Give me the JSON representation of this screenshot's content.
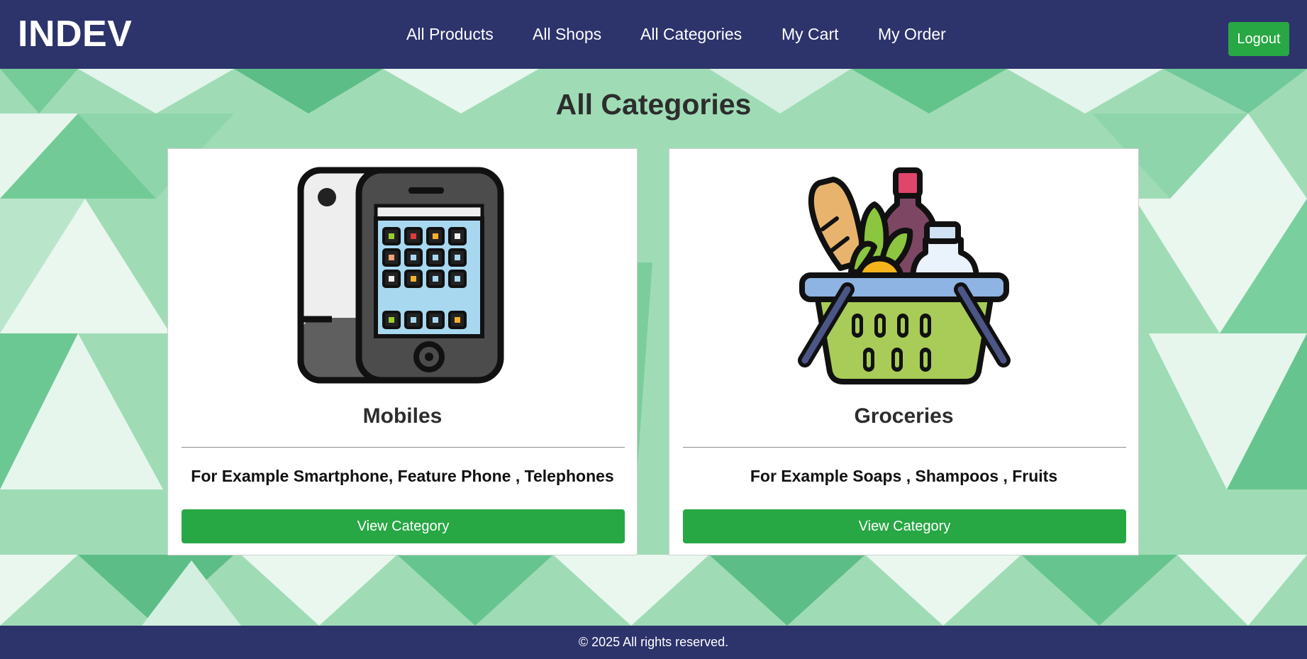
{
  "brand": "INDEV",
  "nav": {
    "links": [
      "All Products",
      "All Shops",
      "All Categories",
      "My Cart",
      "My Order"
    ],
    "logout_label": "Logout"
  },
  "page_title": "All Categories",
  "categories": [
    {
      "name": "Mobiles",
      "description": "For Example Smartphone, Feature Phone , Telephones",
      "button_label": "View Category",
      "image_icon": "phones-icon"
    },
    {
      "name": "Groceries",
      "description": "For Example Soaps , Shampoos , Fruits",
      "button_label": "View Category",
      "image_icon": "grocery-basket-icon"
    }
  ],
  "footer": {
    "copyright": "© 2025 All rights reserved."
  },
  "colors": {
    "header_bg": "#2d336b",
    "accent_green": "#28a745",
    "background_green": "#9fdcb6",
    "card_bg": "#ffffff"
  }
}
